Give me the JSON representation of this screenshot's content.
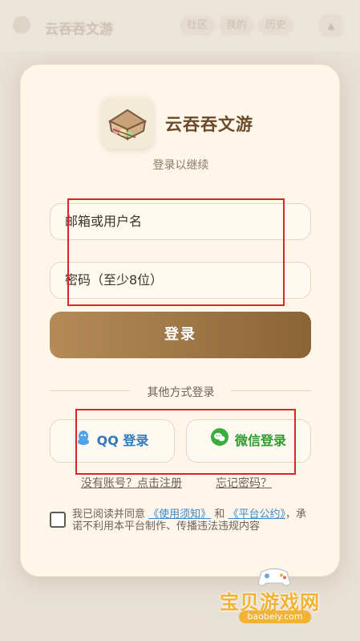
{
  "background": {
    "app_title": "云吞吞文游",
    "tabs": [
      "社区",
      "我的",
      "历史"
    ],
    "arrow": "▲"
  },
  "login": {
    "app_name": "云吞吞文游",
    "subtitle": "登录以继续",
    "username_placeholder": "邮箱或用户名",
    "password_placeholder": "密码（至少8位）",
    "login_button": "登录",
    "divider": "其他方式登录",
    "qq_button": "QQ 登录",
    "wechat_button": "微信登录",
    "register_link": "没有账号？点击注册",
    "forgot_link": "忘记密码？",
    "agree_prefix": "我已阅读并同意",
    "terms_link": "《使用须知》",
    "agree_and": "和",
    "platform_link": "《平台公约》",
    "agree_suffix": "，承诺不利用本平台制作、传播违法违规内容"
  },
  "watermark": {
    "text": "宝贝游戏网",
    "url": "baobeiy.com"
  },
  "colors": {
    "accent": "#8b6436",
    "qq": "#3f86c4",
    "wechat": "#3aae3a",
    "highlight": "#d6252b"
  }
}
